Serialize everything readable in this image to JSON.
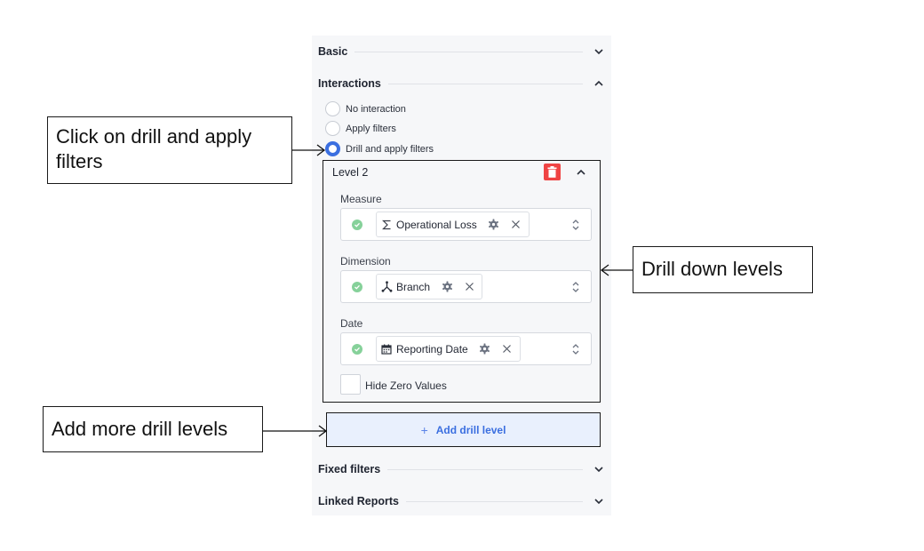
{
  "sections": {
    "basic": "Basic",
    "interactions": "Interactions",
    "fixed_filters": "Fixed filters",
    "linked_reports": "Linked Reports"
  },
  "interaction_options": [
    {
      "label": "No interaction",
      "selected": false
    },
    {
      "label": "Apply filters",
      "selected": false
    },
    {
      "label": "Drill and apply filters",
      "selected": true
    }
  ],
  "level": {
    "title": "Level 2",
    "measure": {
      "label": "Measure",
      "value": "Operational Loss",
      "icon": "sigma-icon"
    },
    "dimension": {
      "label": "Dimension",
      "value": "Branch",
      "icon": "hierarchy-icon"
    },
    "date": {
      "label": "Date",
      "value": "Reporting Date",
      "icon": "calendar-icon"
    },
    "hide_zero": {
      "label": "Hide Zero Values",
      "checked": false
    }
  },
  "add_drill_level": "Add drill level",
  "callouts": {
    "click_drill": "Click on drill and apply filters",
    "drill_levels": "Drill down levels",
    "add_more": "Add more drill levels"
  },
  "colors": {
    "accent": "#3b6fe0",
    "delete": "#ef4444",
    "valid": "#86d19a",
    "panel_bg": "#f6f7f9",
    "add_bg": "#e9f0fd"
  }
}
